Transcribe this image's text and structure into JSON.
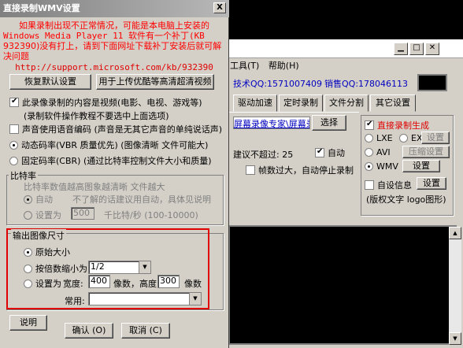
{
  "dialog": {
    "title": "直接录制WMV设置",
    "close_glyph": "X",
    "notice": {
      "line1": "如果录制出现不正常情况，可能是本电脑上安装的",
      "line2": "Windows Media Player 11 软件有一个补丁(KB",
      "line3": "932390)没有打上，请到下面网址下载补丁安装后就可解",
      "line4": "决问题",
      "url": "http://support.microsoft.com/kb/932390"
    },
    "restore_button": "恢复默认设置",
    "upload_button": "用于上传优酷等高清超清视频",
    "opt_video": "此录像录制的内容是视频(电影、电视、游戏等)",
    "opt_video_note": "(录制软件操作教程不要选中上面选项)",
    "opt_mono": "声音使用语音编码 (声音是无其它声音的单纯说话声)",
    "opt_vbr": "动态码率(VBR 质量优先)  (图像清晰 文件可能大)",
    "opt_cbr": "固定码率(CBR) (通过比特率控制文件大小和质量)",
    "bitrate_group": {
      "label": "比特率",
      "hint": "比特率数值越高图象越清晰  文件越大",
      "auto": "自动",
      "auto_note": "不了解的话建议用自动，具体见说明",
      "set_as": "设置为",
      "value": "500",
      "unit": "千比特/秒 (100-10000)"
    },
    "output_group": {
      "label": "输出图像尺寸",
      "original": "原始大小",
      "scale_label": "按倍数缩小为",
      "scale_value": "1/2",
      "set_as": "设置为",
      "width_label": "宽度:",
      "width_value": "400",
      "height_label": "像数，高度:",
      "height_value": "300",
      "unit": "像数",
      "common_label": "常用:",
      "common_value": ""
    },
    "help_button": "说明",
    "ok_button": "确认 (O)",
    "cancel_button": "取消 (C)"
  },
  "background": {
    "menu_tools": "工具(T)",
    "menu_help": "帮助(H)",
    "qq_tech": "技术QQ:1571007409",
    "qq_sales": "销售QQ:178046113",
    "tabs": [
      "驱动加速",
      "定时录制",
      "文件分割",
      "其它设置"
    ],
    "link_text": "屏幕录像专家\\屏幕录像",
    "select_button": "选择",
    "size_limit_label": "建议不超过: 25",
    "auto_label": "自动",
    "auto_stop_label": "帧数过大，自动停止录制",
    "direct_wmv": "直接录制生成",
    "fmt_lxe": "LXE",
    "fmt_exe": "EXE",
    "fmt_avi": "AVI",
    "fmt_wmv": "WMV",
    "settings_btn": "设置",
    "compress_btn": "压缩设置",
    "custom_info": "自设信息",
    "copyright_note": "(版权文字 logo图形)"
  }
}
